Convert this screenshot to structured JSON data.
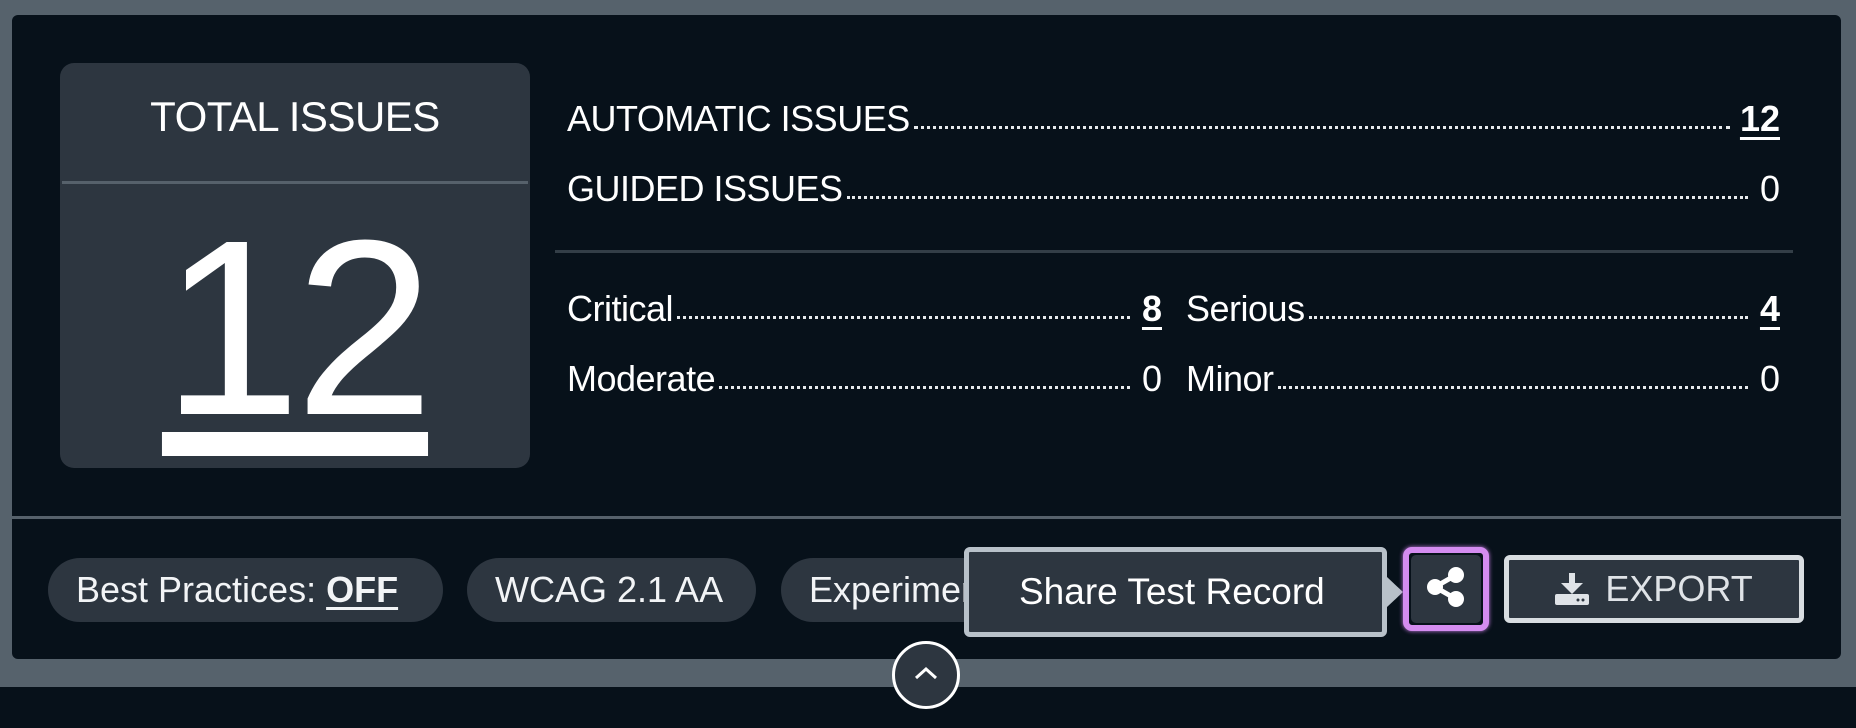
{
  "summary": {
    "total": {
      "heading": "TOTAL ISSUES",
      "value": "12"
    },
    "types": [
      {
        "label": "AUTOMATIC ISSUES",
        "value": "12",
        "link": true
      },
      {
        "label": "GUIDED ISSUES",
        "value": "0",
        "link": false
      }
    ],
    "severity": [
      {
        "label": "Critical",
        "value": "8",
        "link": true
      },
      {
        "label": "Serious",
        "value": "4",
        "link": true
      },
      {
        "label": "Moderate",
        "value": "0",
        "link": false
      },
      {
        "label": "Minor",
        "value": "0",
        "link": false
      }
    ]
  },
  "footer": {
    "pills": [
      {
        "label": "Best Practices:",
        "value": "OFF"
      },
      {
        "label": "WCAG 2.1 AA"
      },
      {
        "label": "Experimental"
      }
    ],
    "tooltip": "Share Test Record",
    "share_icon": "share-icon",
    "export_label": "EXPORT",
    "export_icon": "download-icon",
    "collapse_icon": "chevron-up-icon"
  },
  "colors": {
    "background": "#07111a",
    "card": "#2d3640",
    "focus_ring": "#d48cf0",
    "frame": "#56626c"
  }
}
